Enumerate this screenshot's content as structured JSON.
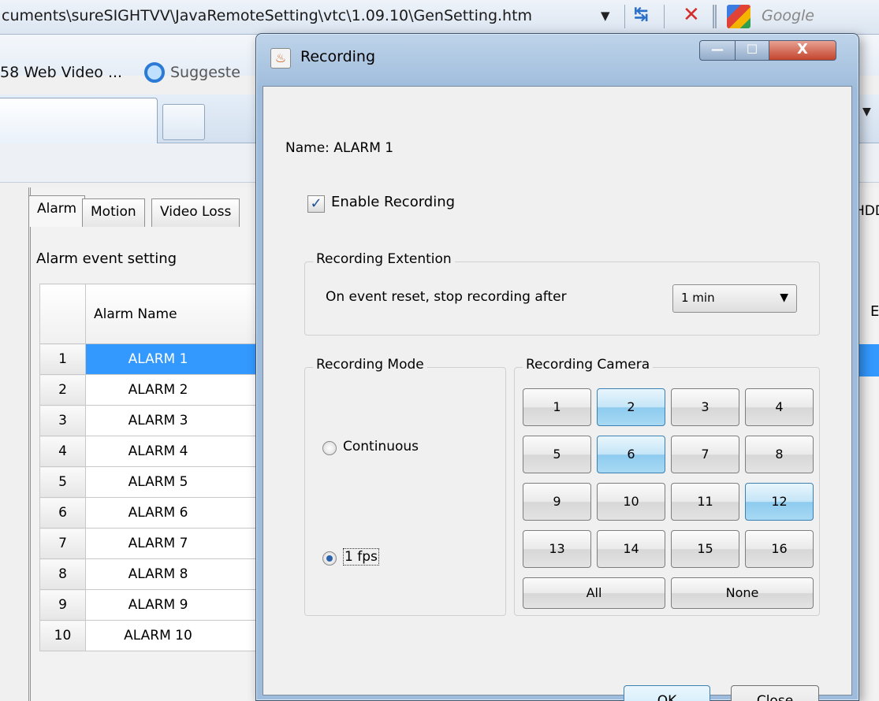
{
  "browser": {
    "address": "cuments\\sureSIGHTVV\\JavaRemoteSetting\\vtc\\1.09.10\\GenSetting.htm",
    "search_placeholder": "Google",
    "favorites": [
      "58 Web Video ...",
      "Suggeste"
    ]
  },
  "app": {
    "tabs": [
      "Alarm",
      "Motion",
      "Video Loss"
    ],
    "tab_partial_right": "HDD",
    "section_title": "Alarm event setting",
    "table_header_name": "Alarm Name",
    "table_header_partial": "E",
    "rows": [
      {
        "num": "1",
        "name": "ALARM 1"
      },
      {
        "num": "2",
        "name": "ALARM 2"
      },
      {
        "num": "3",
        "name": "ALARM 3"
      },
      {
        "num": "4",
        "name": "ALARM 4"
      },
      {
        "num": "5",
        "name": "ALARM 5"
      },
      {
        "num": "6",
        "name": "ALARM 6"
      },
      {
        "num": "7",
        "name": "ALARM 7"
      },
      {
        "num": "8",
        "name": "ALARM 8"
      },
      {
        "num": "9",
        "name": "ALARM 9"
      },
      {
        "num": "10",
        "name": "ALARM 10"
      }
    ],
    "selected_row": 1
  },
  "dialog": {
    "title": "Recording",
    "window_buttons": {
      "minimize": "—",
      "maximize": "☐",
      "close": "X"
    },
    "name_label": "Name: ALARM  1",
    "enable_recording": {
      "label": "Enable Recording",
      "checked": true
    },
    "extension": {
      "group_title": "Recording Extention",
      "text": "On event reset, stop recording after",
      "selected": "1 min"
    },
    "mode": {
      "group_title": "Recording Mode",
      "options": [
        "Continuous",
        "1 fps"
      ],
      "selected": "1 fps"
    },
    "camera": {
      "group_title": "Recording Camera",
      "buttons": [
        "1",
        "2",
        "3",
        "4",
        "5",
        "6",
        "7",
        "8",
        "9",
        "10",
        "11",
        "12",
        "13",
        "14",
        "15",
        "16"
      ],
      "selected": [
        "2",
        "6",
        "12"
      ],
      "all_label": "All",
      "none_label": "None"
    },
    "ok_label": "OK",
    "close_label": "Close"
  }
}
